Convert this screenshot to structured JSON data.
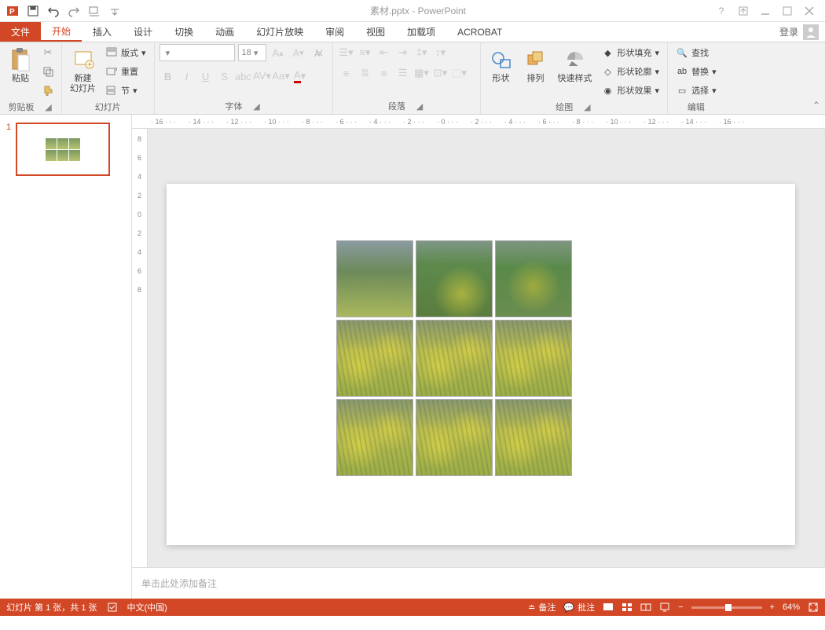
{
  "title": "素材.pptx - PowerPoint",
  "login": "登录",
  "tabs": {
    "file": "文件",
    "home": "开始",
    "insert": "插入",
    "design": "设计",
    "transitions": "切换",
    "animations": "动画",
    "slideshow": "幻灯片放映",
    "review": "审阅",
    "view": "视图",
    "addins": "加载项",
    "acrobat": "ACROBAT"
  },
  "ribbon": {
    "clipboard": {
      "label": "剪贴板",
      "paste": "粘贴"
    },
    "slides": {
      "label": "幻灯片",
      "newSlide": "新建\n幻灯片",
      "layout": "版式",
      "reset": "重置",
      "section": "节"
    },
    "font": {
      "label": "字体",
      "sizeValue": "18"
    },
    "paragraph": {
      "label": "段落"
    },
    "drawing": {
      "label": "绘图",
      "shapes": "形状",
      "arrange": "排列",
      "quickstyles": "快速样式",
      "shapeFill": "形状填充",
      "shapeOutline": "形状轮廓",
      "shapeEffects": "形状效果"
    },
    "editing": {
      "label": "编辑",
      "find": "查找",
      "replace": "替换",
      "select": "选择"
    }
  },
  "ruler": [
    "16",
    "14",
    "12",
    "10",
    "8",
    "6",
    "4",
    "2",
    "0",
    "2",
    "4",
    "6",
    "8",
    "10",
    "12",
    "14",
    "16"
  ],
  "vruler": [
    "8",
    "6",
    "4",
    "2",
    "0",
    "2",
    "4",
    "6",
    "8"
  ],
  "thumb": {
    "num": "1"
  },
  "notes": {
    "placeholder": "单击此处添加备注"
  },
  "status": {
    "slideInfo": "幻灯片 第 1 张，共 1 张",
    "language": "中文(中国)",
    "notesBtn": "备注",
    "commentsBtn": "批注",
    "zoomPct": "64%"
  }
}
